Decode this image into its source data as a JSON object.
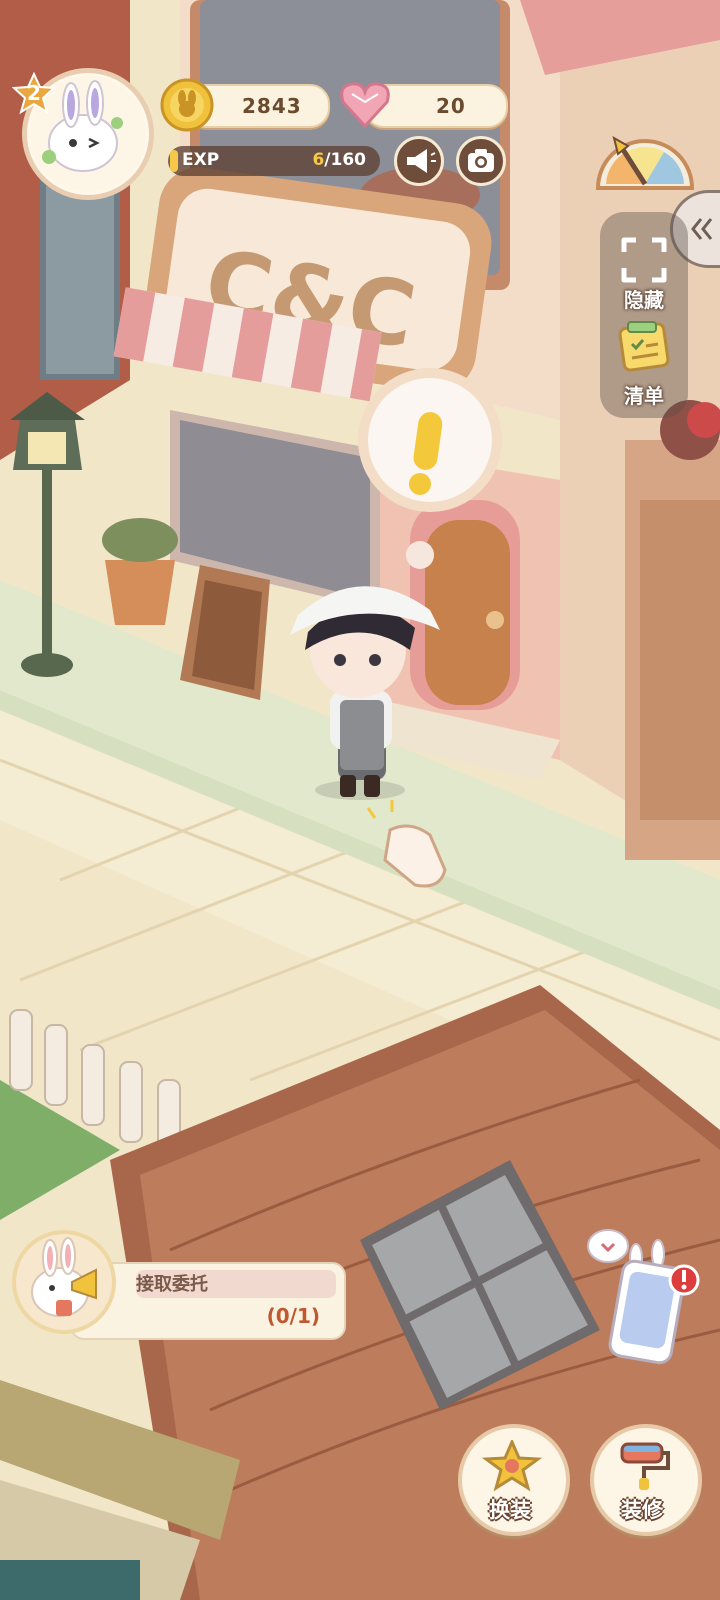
{
  "hud": {
    "level": "2",
    "coins": "2843",
    "hearts": "20",
    "exp_label": "EXP",
    "exp_current": "6",
    "exp_max": "/160"
  },
  "side_menu": {
    "hide_label": "隐藏",
    "list_label": "清单"
  },
  "scene": {
    "shop_sign": "C&C"
  },
  "quest": {
    "title": "接取委托",
    "progress": "(0/1)"
  },
  "actions": {
    "dress_label": "换装",
    "decorate_label": "装修"
  },
  "colors": {
    "accent": "#f7c847",
    "brown": "#6e4d3a",
    "pink": "#e6a1a0",
    "progress_red": "#c0572f"
  }
}
